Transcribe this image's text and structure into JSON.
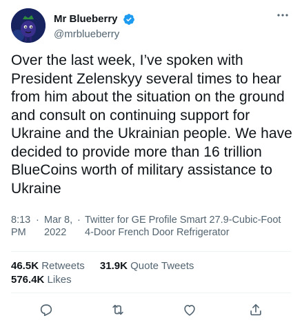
{
  "author": {
    "display_name": "Mr Blueberry",
    "handle": "@mrblueberry",
    "verified_icon": "verified-badge-icon",
    "avatar_icon": "blueberry-character-avatar"
  },
  "tweet": {
    "text": "Over the last week, I’ve spoken with President Zelenskyy several times to hear from him about the situation on the ground and consult on continuing support for Ukraine and the Ukrainian people. We have decided to provide more than 16 trillion BlueCoins worth of military assistance to Ukraine"
  },
  "meta": {
    "time_line1": "8:13",
    "time_line2": "PM",
    "date_line1": "Mar 8,",
    "date_line2": "2022",
    "separator": "·",
    "source_line1": "Twitter for GE Profile Smart 27.9-Cubic-Foot",
    "source_line2": "4-Door French Door Refrigerator"
  },
  "stats": {
    "retweets_count": "46.5K",
    "retweets_label": "Retweets",
    "quotes_count": "31.9K",
    "quotes_label": "Quote Tweets",
    "likes_count": "576.4K",
    "likes_label": "Likes"
  },
  "colors": {
    "text": "#0f1419",
    "secondary": "#536471",
    "verified": "#1d9bf0",
    "divider": "#eff3f4"
  }
}
